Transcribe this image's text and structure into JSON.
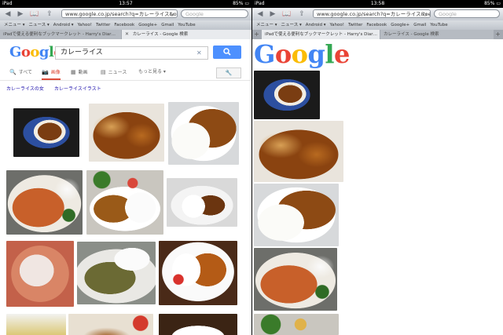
{
  "left": {
    "status": {
      "device": "iPad",
      "time": "13:57",
      "battery": "85%"
    },
    "toolbar": {
      "url": "www.google.co.jp/search?q=カレーライス&oe=",
      "search_placeholder": "Google",
      "icons": [
        "back-icon",
        "forward-icon",
        "bookmarks-icon",
        "share-icon",
        "reload-icon"
      ]
    },
    "bookmarks": [
      "メニュー ▾",
      "ニュース ▾",
      "Android ▾",
      "Yahoo!",
      "Twitter",
      "Facebook",
      "Google+",
      "Gmail",
      "YouTube"
    ],
    "tabs": [
      {
        "label": "iPadで使える便利なブックマークレット - Harry's Diar…",
        "active": false
      },
      {
        "label": "カレーライス - Google 検索",
        "active": true
      }
    ],
    "google": {
      "logo": "Google",
      "query": "カレーライス",
      "tools": [
        {
          "label": "すべて",
          "icon": "search-icon",
          "selected": false
        },
        {
          "label": "画像",
          "icon": "camera-icon",
          "selected": true
        },
        {
          "label": "動画",
          "icon": "video-icon",
          "selected": false
        },
        {
          "label": "ニュース",
          "icon": "news-icon",
          "selected": false
        },
        {
          "label": "もっと見る ▾",
          "icon": "",
          "selected": false
        }
      ],
      "tools_button_icon": "wrench-icon",
      "suggestions": [
        "カレーライスの女",
        "カレーライスイラスト"
      ]
    }
  },
  "right": {
    "status": {
      "device": "iPad",
      "time": "13:58",
      "battery": "85%"
    },
    "toolbar": {
      "url": "www.google.co.jp/search?q=カレーライス&oe=",
      "search_placeholder": "Google"
    },
    "bookmarks": [
      "メニュー ▾",
      "ニュース ▾",
      "Android ▾",
      "Yahoo!",
      "Twitter",
      "Facebook",
      "Google+",
      "Gmail",
      "YouTube"
    ],
    "tabs": [
      {
        "label": "iPadで使える便利なブックマークレット - Harry's Diar…",
        "active": true
      },
      {
        "label": "カレーライス - Google 検索",
        "active": false
      }
    ],
    "google": {
      "logo": "Google"
    }
  },
  "colors": {
    "google_blue": "#4285f4",
    "google_red": "#ea4335",
    "google_yellow": "#fbbc05",
    "google_green": "#34a853",
    "selected_tab": "#dd4b39",
    "link": "#1a0dab",
    "search_button": "#4d90fe"
  }
}
